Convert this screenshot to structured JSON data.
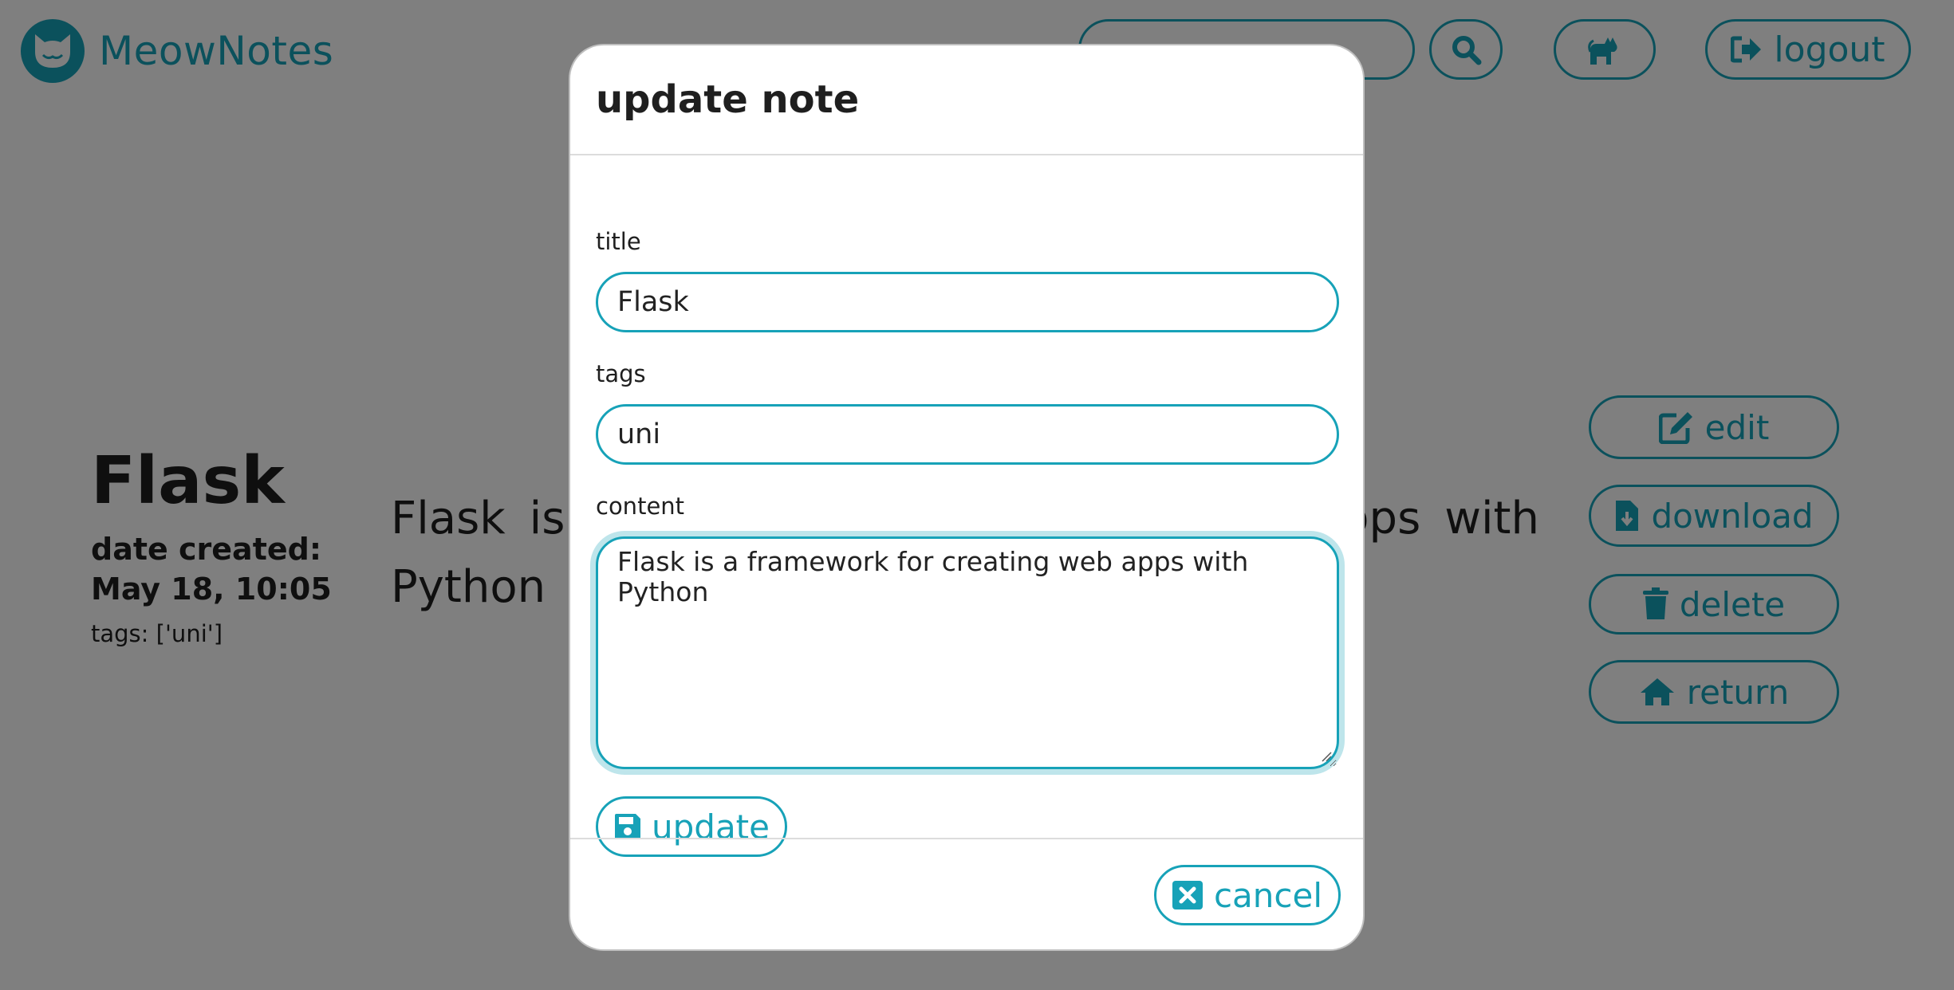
{
  "app": {
    "name": "MeowNotes"
  },
  "nav": {
    "search_placeholder": "",
    "search_icon": "search-icon",
    "cat_icon": "cat-icon",
    "logout_label": "logout"
  },
  "note": {
    "title": "Flask",
    "date_label": "date created:",
    "date_value": "May 18, 10:05",
    "tags_text": "tags: ['uni']",
    "content": "Flask is a framework for creating web apps with Python"
  },
  "actions": {
    "edit": "edit",
    "download": "download",
    "delete": "delete",
    "return": "return"
  },
  "modal": {
    "title": "update note",
    "title_label": "title",
    "title_value": "Flask",
    "tags_label": "tags",
    "tags_value": "uni",
    "content_label": "content",
    "content_value": "Flask is a framework for creating web apps with Python",
    "update_label": "update",
    "cancel_label": "cancel"
  },
  "colors": {
    "accent": "#17a2b8",
    "overlay": "rgba(0,0,0,0.5)"
  }
}
